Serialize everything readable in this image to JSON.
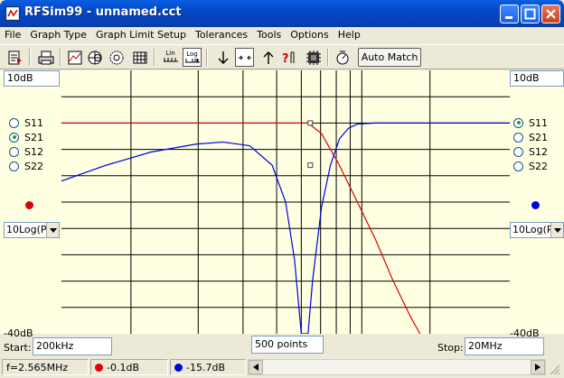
{
  "window": {
    "title": "RFSim99 - unnamed.cct"
  },
  "menu": [
    "File",
    "Graph Type",
    "Graph Limit Setup",
    "Tolerances",
    "Tools",
    "Options",
    "Help"
  ],
  "toolbar": {
    "icons": [
      "save-icon",
      "print-icon",
      "graph-icon",
      "smith-chart-icon",
      "polar-icon",
      "table-icon",
      "lin-scale-icon",
      "log-scale-icon",
      "down-arrow-icon",
      "zoom-icon",
      "up-arrow-icon",
      "help-icon",
      "component-icon",
      "measure-icon"
    ],
    "lin_top": "Lin",
    "log_top": "Log",
    "auto_match_label": "Auto Match"
  },
  "left_panel": {
    "top_limit": "10dB",
    "bottom_limit": "-40dB",
    "params": [
      {
        "label": "S11",
        "selected": false
      },
      {
        "label": "S21",
        "selected": true
      },
      {
        "label": "S12",
        "selected": false
      },
      {
        "label": "S22",
        "selected": false
      }
    ],
    "trace_color": "#e00000",
    "format": "10Log(P"
  },
  "right_panel": {
    "top_limit": "10dB",
    "bottom_limit": "-40dB",
    "params": [
      {
        "label": "S11",
        "selected": true
      },
      {
        "label": "S21",
        "selected": false
      },
      {
        "label": "S12",
        "selected": false
      },
      {
        "label": "S22",
        "selected": false
      }
    ],
    "trace_color": "#0000e0",
    "format": "10Log(P"
  },
  "sweep": {
    "start_label": "Start:",
    "start_value": "200kHz",
    "points_value": "500 points",
    "stop_label": "Stop:",
    "stop_value": "20MHz"
  },
  "status": {
    "frequency": "f=2.565MHz",
    "red_value": "-0.1dB",
    "blue_value": "-15.7dB",
    "red_color": "#e00000",
    "blue_color": "#0000e0"
  },
  "chart_data": {
    "type": "line",
    "ylim": [
      -40,
      10
    ],
    "grid": true,
    "series": [
      {
        "color": "#e00000",
        "description_of_trace": "S21",
        "points": [
          [
            0,
            0
          ],
          [
            0.55,
            0
          ],
          [
            0.58,
            -2
          ],
          [
            0.62,
            -8
          ],
          [
            0.66,
            -15
          ],
          [
            0.7,
            -22
          ],
          [
            0.74,
            -30
          ],
          [
            0.78,
            -37
          ],
          [
            0.8,
            -40
          ]
        ]
      },
      {
        "color": "#0000e0",
        "description_of_trace": "S11",
        "points": [
          [
            0,
            -11
          ],
          [
            0.1,
            -8
          ],
          [
            0.2,
            -5.5
          ],
          [
            0.3,
            -4
          ],
          [
            0.36,
            -3.6
          ],
          [
            0.42,
            -4.3
          ],
          [
            0.47,
            -8
          ],
          [
            0.5,
            -15
          ],
          [
            0.52,
            -26
          ],
          [
            0.535,
            -40
          ],
          [
            0.55,
            -40
          ],
          [
            0.56,
            -30
          ],
          [
            0.58,
            -16
          ],
          [
            0.6,
            -8
          ],
          [
            0.62,
            -3
          ],
          [
            0.64,
            -1
          ],
          [
            0.66,
            -0.2
          ],
          [
            0.7,
            0
          ],
          [
            1.0,
            0
          ]
        ]
      }
    ]
  }
}
